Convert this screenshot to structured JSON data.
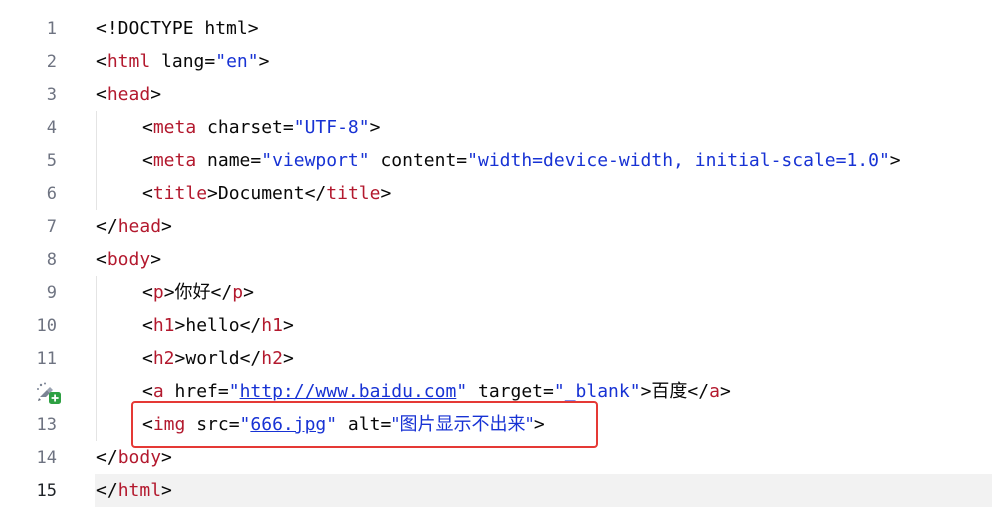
{
  "editor": {
    "lines": [
      {
        "num": "1",
        "current": false,
        "indent": false,
        "tokens": [
          {
            "t": "<!DOCTYPE html>",
            "c": "c-text"
          }
        ]
      },
      {
        "num": "2",
        "current": false,
        "indent": false,
        "tokens": [
          {
            "t": "<",
            "c": "c-br"
          },
          {
            "t": "html",
            "c": "c-tag"
          },
          {
            "t": " lang=",
            "c": "c-text"
          },
          {
            "t": "\"en\"",
            "c": "c-val"
          },
          {
            "t": ">",
            "c": "c-br"
          }
        ]
      },
      {
        "num": "3",
        "current": false,
        "indent": false,
        "tokens": [
          {
            "t": "<",
            "c": "c-br"
          },
          {
            "t": "head",
            "c": "c-tag"
          },
          {
            "t": ">",
            "c": "c-br"
          }
        ]
      },
      {
        "num": "4",
        "current": false,
        "indent": true,
        "tokens": [
          {
            "t": "<",
            "c": "c-br"
          },
          {
            "t": "meta",
            "c": "c-tag"
          },
          {
            "t": " charset=",
            "c": "c-text"
          },
          {
            "t": "\"UTF-8\"",
            "c": "c-val"
          },
          {
            "t": ">",
            "c": "c-br"
          }
        ]
      },
      {
        "num": "5",
        "current": false,
        "indent": true,
        "tokens": [
          {
            "t": "<",
            "c": "c-br"
          },
          {
            "t": "meta",
            "c": "c-tag"
          },
          {
            "t": " name=",
            "c": "c-text"
          },
          {
            "t": "\"viewport\"",
            "c": "c-val"
          },
          {
            "t": " content=",
            "c": "c-text"
          },
          {
            "t": "\"width=device-width, initial-scale=1.0\"",
            "c": "c-val"
          },
          {
            "t": ">",
            "c": "c-br"
          }
        ]
      },
      {
        "num": "6",
        "current": false,
        "indent": true,
        "tokens": [
          {
            "t": "<",
            "c": "c-br"
          },
          {
            "t": "title",
            "c": "c-tag"
          },
          {
            "t": ">",
            "c": "c-br"
          },
          {
            "t": "Document",
            "c": "c-text"
          },
          {
            "t": "</",
            "c": "c-br"
          },
          {
            "t": "title",
            "c": "c-tag"
          },
          {
            "t": ">",
            "c": "c-br"
          }
        ]
      },
      {
        "num": "7",
        "current": false,
        "indent": false,
        "tokens": [
          {
            "t": "</",
            "c": "c-br"
          },
          {
            "t": "head",
            "c": "c-tag"
          },
          {
            "t": ">",
            "c": "c-br"
          }
        ]
      },
      {
        "num": "8",
        "current": false,
        "indent": false,
        "tokens": [
          {
            "t": "<",
            "c": "c-br"
          },
          {
            "t": "body",
            "c": "c-tag"
          },
          {
            "t": ">",
            "c": "c-br"
          }
        ]
      },
      {
        "num": "9",
        "current": false,
        "indent": true,
        "tokens": [
          {
            "t": "<",
            "c": "c-br"
          },
          {
            "t": "p",
            "c": "c-tag"
          },
          {
            "t": ">",
            "c": "c-br"
          },
          {
            "t": "你好",
            "c": "c-text c-cjk"
          },
          {
            "t": "</",
            "c": "c-br"
          },
          {
            "t": "p",
            "c": "c-tag"
          },
          {
            "t": ">",
            "c": "c-br"
          }
        ]
      },
      {
        "num": "10",
        "current": false,
        "indent": true,
        "tokens": [
          {
            "t": "<",
            "c": "c-br"
          },
          {
            "t": "h1",
            "c": "c-tag"
          },
          {
            "t": ">",
            "c": "c-br"
          },
          {
            "t": "hello",
            "c": "c-text"
          },
          {
            "t": "</",
            "c": "c-br"
          },
          {
            "t": "h1",
            "c": "c-tag"
          },
          {
            "t": ">",
            "c": "c-br"
          }
        ]
      },
      {
        "num": "11",
        "current": false,
        "indent": true,
        "tokens": [
          {
            "t": "<",
            "c": "c-br"
          },
          {
            "t": "h2",
            "c": "c-tag"
          },
          {
            "t": ">",
            "c": "c-br"
          },
          {
            "t": "world",
            "c": "c-text"
          },
          {
            "t": "</",
            "c": "c-br"
          },
          {
            "t": "h2",
            "c": "c-tag"
          },
          {
            "t": ">",
            "c": "c-br"
          }
        ]
      },
      {
        "num": "",
        "current": false,
        "indent": true,
        "icon": true,
        "tokens": [
          {
            "t": "<",
            "c": "c-br"
          },
          {
            "t": "a",
            "c": "c-tag"
          },
          {
            "t": " href=",
            "c": "c-text"
          },
          {
            "t": "\"",
            "c": "c-val"
          },
          {
            "t": "http://www.baidu.com",
            "c": "c-link"
          },
          {
            "t": "\"",
            "c": "c-val"
          },
          {
            "t": " target=",
            "c": "c-text"
          },
          {
            "t": "\"_blank\"",
            "c": "c-val"
          },
          {
            "t": ">",
            "c": "c-br"
          },
          {
            "t": "百度",
            "c": "c-text c-cjk"
          },
          {
            "t": "</",
            "c": "c-br"
          },
          {
            "t": "a",
            "c": "c-tag"
          },
          {
            "t": ">",
            "c": "c-br"
          }
        ]
      },
      {
        "num": "13",
        "current": false,
        "indent": true,
        "tokens": [
          {
            "t": "<",
            "c": "c-br"
          },
          {
            "t": "img",
            "c": "c-tag"
          },
          {
            "t": " src=",
            "c": "c-text"
          },
          {
            "t": "\"",
            "c": "c-val"
          },
          {
            "t": "666.jpg",
            "c": "c-link"
          },
          {
            "t": "\"",
            "c": "c-val"
          },
          {
            "t": " alt=",
            "c": "c-text"
          },
          {
            "t": "\"图片显示不出来\"",
            "c": "c-val c-cjk"
          },
          {
            "t": ">",
            "c": "c-br"
          }
        ]
      },
      {
        "num": "14",
        "current": false,
        "indent": false,
        "tokens": [
          {
            "t": "</",
            "c": "c-br"
          },
          {
            "t": "body",
            "c": "c-tag"
          },
          {
            "t": ">",
            "c": "c-br"
          }
        ]
      },
      {
        "num": "15",
        "current": true,
        "indent": false,
        "tokens": [
          {
            "t": "</",
            "c": "c-br"
          },
          {
            "t": "html",
            "c": "c-tag"
          },
          {
            "t": ">",
            "c": "c-br"
          }
        ]
      }
    ],
    "gutter_icon": "add-image-gutter-icon",
    "colors": {
      "tag": "#b3192e",
      "value": "#1732d4",
      "highlight": "#e53935"
    }
  }
}
